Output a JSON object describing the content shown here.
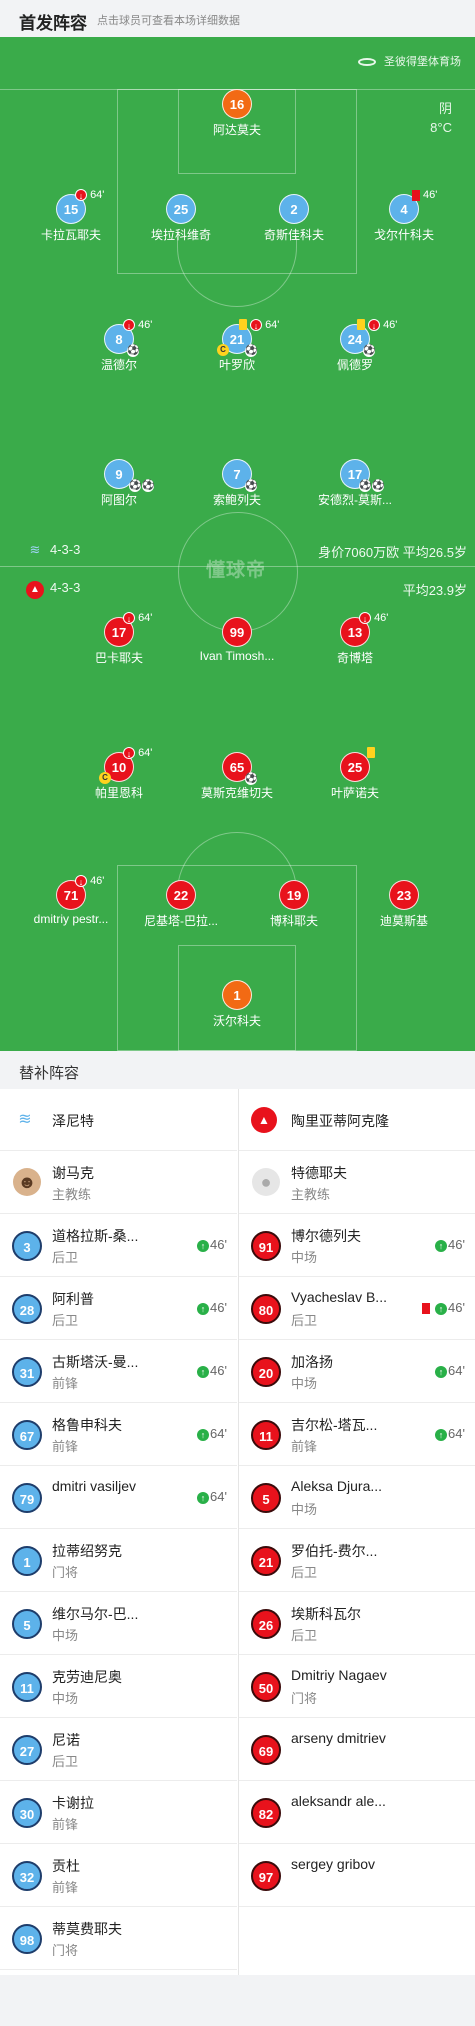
{
  "header": {
    "title": "首发阵容",
    "subtitle": "点击球员可查看本场详细数据"
  },
  "venue": "圣彼得堡体育场",
  "weather": {
    "condition": "阴",
    "temp": "8°C"
  },
  "home": {
    "formation": "4-3-3",
    "market": "身价7060万欧 平均26.5岁",
    "color": "#5db2ea",
    "players": [
      {
        "num": "16",
        "name": "阿达莫夫",
        "color": "orange"
      },
      {
        "num": "15",
        "name": "卡拉瓦耶夫",
        "sub": "64'"
      },
      {
        "num": "25",
        "name": "埃拉科维奇"
      },
      {
        "num": "2",
        "name": "奇斯佳科夫"
      },
      {
        "num": "4",
        "name": "戈尔什科夫",
        "sub": "46'"
      },
      {
        "num": "8",
        "name": "温德尔",
        "sub": "46'"
      },
      {
        "num": "21",
        "name": "叶罗欣",
        "sub": "64'",
        "yellow": true,
        "captain": "C"
      },
      {
        "num": "24",
        "name": "佩德罗",
        "sub": "46'",
        "yellow": true
      },
      {
        "num": "9",
        "name": "阿图尔"
      },
      {
        "num": "7",
        "name": "索鲍列夫"
      },
      {
        "num": "17",
        "name": "安德烈-莫斯..."
      }
    ]
  },
  "away": {
    "formation": "4-3-3",
    "market": "平均23.9岁",
    "color": "#e8121c",
    "players": [
      {
        "num": "17",
        "name": "巴卡耶夫",
        "sub": "64'"
      },
      {
        "num": "99",
        "name": "Ivan Timosh..."
      },
      {
        "num": "13",
        "name": "奇博塔",
        "sub": "46'"
      },
      {
        "num": "10",
        "name": "帕里恩科",
        "sub": "64'",
        "captain": "C"
      },
      {
        "num": "65",
        "name": "莫斯克维切夫"
      },
      {
        "num": "25",
        "name": "叶萨诺夫",
        "yellow": true
      },
      {
        "num": "71",
        "name": "dmitriy pestr...",
        "sub": "46'"
      },
      {
        "num": "22",
        "name": "尼基塔-巴拉..."
      },
      {
        "num": "19",
        "name": "博科耶夫"
      },
      {
        "num": "23",
        "name": "迪莫斯基"
      },
      {
        "num": "1",
        "name": "沃尔科夫",
        "color": "orange"
      }
    ]
  },
  "watermark": "懂球帝",
  "subs": {
    "title": "替补阵容",
    "home": {
      "team": "泽尼特",
      "coach": {
        "name": "谢马克",
        "role": "主教练"
      },
      "players": [
        {
          "num": "3",
          "name": "道格拉斯-桑...",
          "pos": "后卫",
          "time": "46'"
        },
        {
          "num": "28",
          "name": "阿利普",
          "pos": "后卫",
          "time": "46'"
        },
        {
          "num": "31",
          "name": "古斯塔沃-曼...",
          "pos": "前锋",
          "time": "46'"
        },
        {
          "num": "67",
          "name": "格鲁申科夫",
          "pos": "前锋",
          "time": "64'"
        },
        {
          "num": "79",
          "name": "dmitri vasiljev",
          "pos": "",
          "time": "64'"
        },
        {
          "num": "1",
          "name": "拉蒂绍努克",
          "pos": "门将"
        },
        {
          "num": "5",
          "name": "维尔马尔-巴...",
          "pos": "中场"
        },
        {
          "num": "11",
          "name": "克劳迪尼奥",
          "pos": "中场"
        },
        {
          "num": "27",
          "name": "尼诺",
          "pos": "后卫"
        },
        {
          "num": "30",
          "name": "卡谢拉",
          "pos": "前锋"
        },
        {
          "num": "32",
          "name": "贡杜",
          "pos": "前锋"
        },
        {
          "num": "98",
          "name": "蒂莫费耶夫",
          "pos": "门将"
        }
      ]
    },
    "away": {
      "team": "陶里亚蒂阿克隆",
      "coach": {
        "name": "特德耶夫",
        "role": "主教练"
      },
      "players": [
        {
          "num": "91",
          "name": "博尔德列夫",
          "pos": "中场",
          "time": "46'"
        },
        {
          "num": "80",
          "name": "Vyacheslav B...",
          "pos": "后卫",
          "time": "46'",
          "red": true
        },
        {
          "num": "20",
          "name": "加洛扬",
          "pos": "中场",
          "time": "64'"
        },
        {
          "num": "11",
          "name": "吉尔松-塔瓦...",
          "pos": "前锋",
          "time": "64'"
        },
        {
          "num": "5",
          "name": "Aleksa Djura...",
          "pos": "中场"
        },
        {
          "num": "21",
          "name": "罗伯托-费尔...",
          "pos": "后卫"
        },
        {
          "num": "26",
          "name": "埃斯科瓦尔",
          "pos": "后卫"
        },
        {
          "num": "50",
          "name": "Dmitriy Nagaev",
          "pos": "门将"
        },
        {
          "num": "69",
          "name": "arseny dmitriev",
          "pos": ""
        },
        {
          "num": "82",
          "name": "aleksandr ale...",
          "pos": ""
        },
        {
          "num": "97",
          "name": "sergey gribov",
          "pos": ""
        }
      ]
    }
  }
}
